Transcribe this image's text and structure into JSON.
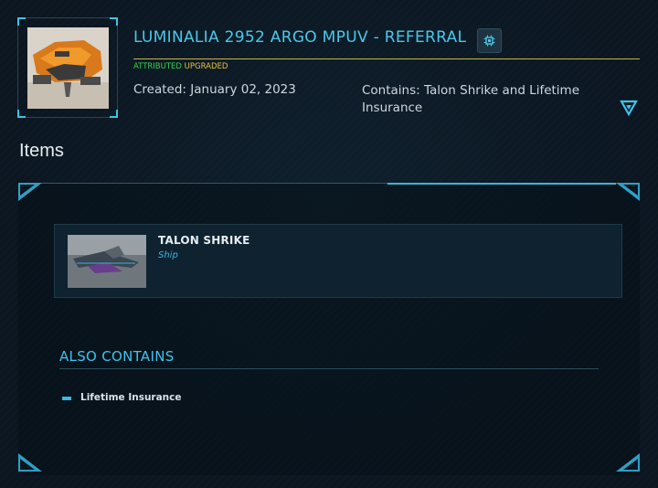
{
  "pledge": {
    "title": "LUMINALIA 2952 ARGO MPUV - REFERRAL",
    "badge_attributed": "ATTRIBUTED",
    "badge_upgraded": "UPGRADED",
    "created": "Created: January 02, 2023",
    "contains": "Contains: Talon Shrike and Lifetime Insurance"
  },
  "items_section": {
    "title": "Items",
    "items": [
      {
        "name": "TALON SHRIKE",
        "type": "Ship"
      }
    ]
  },
  "also_contains": {
    "title": "ALSO CONTAINS",
    "items": [
      {
        "label": "Lifetime Insurance"
      }
    ]
  },
  "colors": {
    "accent": "#49c8ea",
    "attributed": "#38d24a",
    "upgraded": "#e9c234",
    "background": "#0b1621"
  },
  "icons": {
    "chip": "chip-icon",
    "expand": "chevron-down-icon"
  }
}
